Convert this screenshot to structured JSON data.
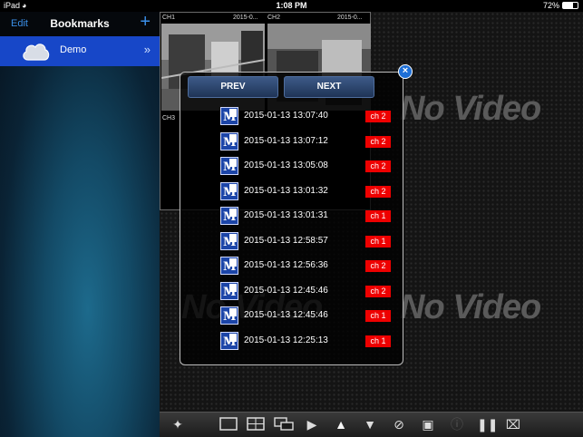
{
  "status_bar": {
    "carrier": "iPad",
    "time": "1:08 PM",
    "battery": "72%",
    "battery_level": 0.72
  },
  "sidebar": {
    "edit_label": "Edit",
    "title": "Bookmarks",
    "add_icon": "plus-icon",
    "items": [
      {
        "label": "Demo",
        "icon": "cloud-icon",
        "chevron": "»"
      }
    ]
  },
  "video": {
    "no_video_text": "No Video",
    "cameras": [
      {
        "channel": "CH1",
        "date": "2015-0..."
      },
      {
        "channel": "CH2",
        "date": "2015-0..."
      },
      {
        "channel": "CH3"
      }
    ]
  },
  "popup": {
    "prev_label": "PREV",
    "next_label": "NEXT",
    "close_icon": "close-icon",
    "entries": [
      {
        "timestamp": "2015-01-13 13:07:40",
        "channel": "ch 2"
      },
      {
        "timestamp": "2015-01-13 13:07:12",
        "channel": "ch 2"
      },
      {
        "timestamp": "2015-01-13 13:05:08",
        "channel": "ch 2"
      },
      {
        "timestamp": "2015-01-13 13:01:32",
        "channel": "ch 2"
      },
      {
        "timestamp": "2015-01-13 13:01:31",
        "channel": "ch 1"
      },
      {
        "timestamp": "2015-01-13 12:58:57",
        "channel": "ch 1"
      },
      {
        "timestamp": "2015-01-13 12:56:36",
        "channel": "ch 2"
      },
      {
        "timestamp": "2015-01-13 12:45:46",
        "channel": "ch 2"
      },
      {
        "timestamp": "2015-01-13 12:45:46",
        "channel": "ch 1"
      },
      {
        "timestamp": "2015-01-13 12:25:13",
        "channel": "ch 1"
      }
    ]
  },
  "toolbar": {
    "icons": [
      "ptz-icon",
      "single-view-icon",
      "quad-view-icon",
      "sequence-view-icon",
      "play-icon",
      "alarm-icon",
      "dome-camera-icon",
      "disable-icon",
      "snapshot-icon",
      "info-icon",
      "pause-icon",
      "fullscreen-icon"
    ]
  },
  "colors": {
    "accent_blue": "#1747c8",
    "channel_badge": "#ee0000",
    "link_blue": "#3a8fe8"
  }
}
